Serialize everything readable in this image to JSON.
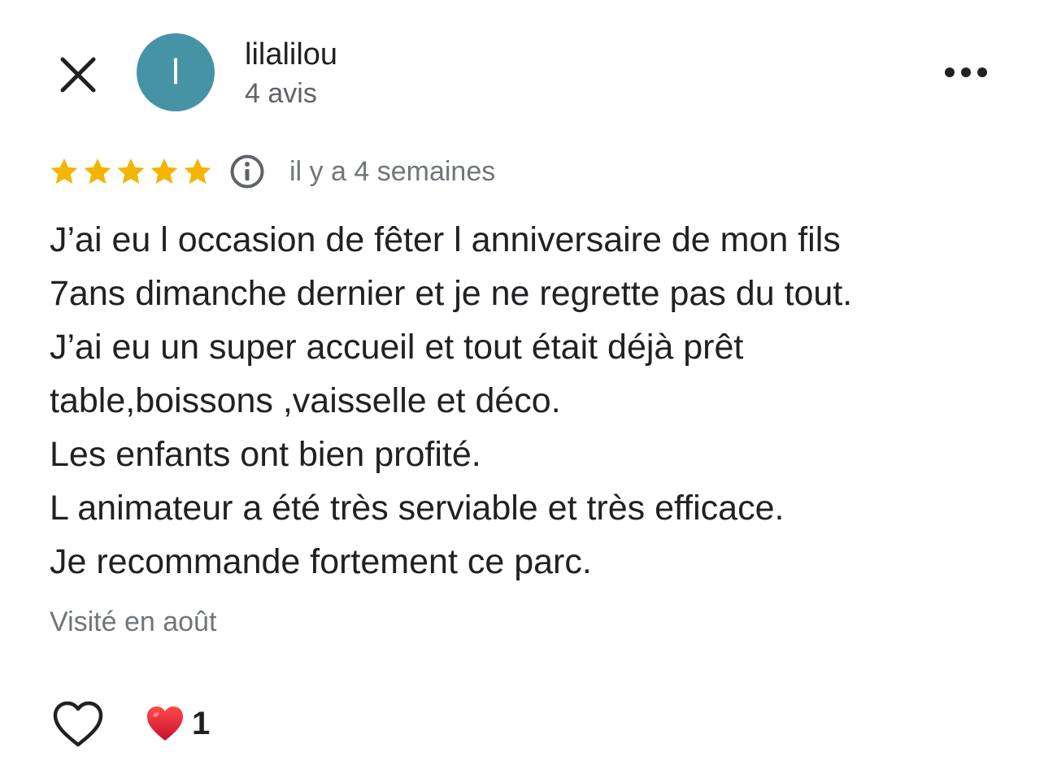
{
  "header": {
    "close_icon": "close-icon",
    "avatar_letter": "l",
    "avatar_color": "#4693a6",
    "user_name": "lilalilou",
    "review_count": "4 avis",
    "more_icon": "more-horizontal-icon"
  },
  "rating": {
    "stars": 5,
    "max_stars": 5,
    "star_color": "#f4b400",
    "info_icon": "info-icon",
    "time_ago": "il y a 4 semaines"
  },
  "review": {
    "text": "J’ai eu l occasion de fêter l anniversaire de mon fils\n7ans dimanche dernier et je ne regrette pas du tout.\nJ’ai eu un super accueil et tout était déjà prêt\ntable,boissons ,vaisselle et déco.\nLes enfants ont bien profité.\nL animateur a été très serviable et très efficace.\nJe recommande fortement ce parc.",
    "visited": "Visité en août"
  },
  "actions": {
    "like_icon": "heart-outline-icon",
    "reaction_icon": "red-heart-icon",
    "reaction_count": "1"
  }
}
